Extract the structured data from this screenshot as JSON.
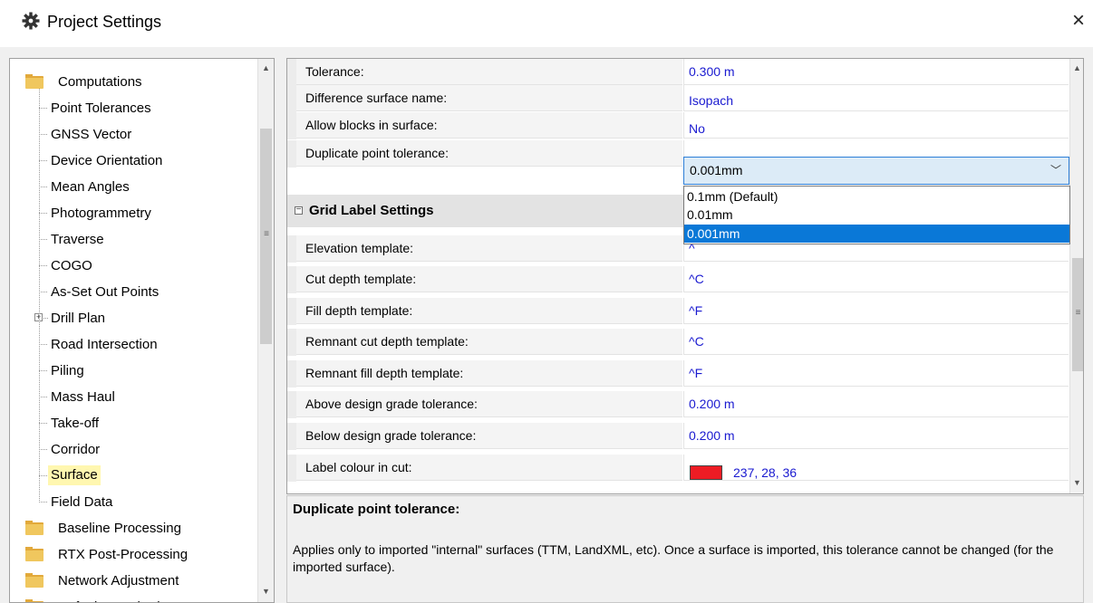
{
  "window": {
    "title": "Project Settings",
    "close_label": "×"
  },
  "tree": {
    "items": [
      {
        "label": "Computations",
        "type": "folder"
      },
      {
        "label": "Point Tolerances",
        "type": "leaf"
      },
      {
        "label": "GNSS Vector",
        "type": "leaf"
      },
      {
        "label": "Device Orientation",
        "type": "leaf"
      },
      {
        "label": "Mean Angles",
        "type": "leaf"
      },
      {
        "label": "Photogrammetry",
        "type": "leaf"
      },
      {
        "label": "Traverse",
        "type": "leaf"
      },
      {
        "label": "COGO",
        "type": "leaf"
      },
      {
        "label": "As-Set Out Points",
        "type": "leaf"
      },
      {
        "label": "Drill Plan",
        "type": "expandable"
      },
      {
        "label": "Road Intersection",
        "type": "leaf"
      },
      {
        "label": "Piling",
        "type": "leaf"
      },
      {
        "label": "Mass Haul",
        "type": "leaf"
      },
      {
        "label": "Take-off",
        "type": "leaf"
      },
      {
        "label": "Corridor",
        "type": "leaf"
      },
      {
        "label": "Surface",
        "type": "leaf",
        "selected": true
      },
      {
        "label": "Field Data",
        "type": "leaf"
      },
      {
        "label": "Baseline Processing",
        "type": "folder"
      },
      {
        "label": "RTX Post-Processing",
        "type": "folder"
      },
      {
        "label": "Network Adjustment",
        "type": "folder"
      },
      {
        "label": "Default Standard Errors",
        "type": "folder"
      }
    ]
  },
  "grid": {
    "rows_top": [
      {
        "name": "Tolerance:",
        "value": "0.300 m"
      },
      {
        "name": "Difference surface name:",
        "value": "Isopach"
      },
      {
        "name": "Allow blocks in surface:",
        "value": "No"
      },
      {
        "name": "Duplicate point tolerance:",
        "value": ""
      }
    ],
    "category": {
      "label": "Grid Label Settings",
      "toggle": "−"
    },
    "rows_bottom": [
      {
        "name": "Elevation template:",
        "value": "^"
      },
      {
        "name": "Cut depth template:",
        "value": "^C"
      },
      {
        "name": "Fill depth template:",
        "value": "^F"
      },
      {
        "name": "Remnant cut depth template:",
        "value": "^C"
      },
      {
        "name": "Remnant fill depth template:",
        "value": "^F"
      },
      {
        "name": "Above design grade tolerance:",
        "value": "0.200 m"
      },
      {
        "name": "Below design grade tolerance:",
        "value": "0.200 m"
      },
      {
        "name": "Label colour in cut:",
        "value": "237, 28, 36",
        "swatch_color": "#ed1c24"
      }
    ]
  },
  "combo": {
    "selected": "0.001mm",
    "options": [
      "0.1mm (Default)",
      "0.01mm",
      "0.001mm"
    ],
    "highlighted_index": 2
  },
  "description": {
    "title": "Duplicate point tolerance:",
    "body": "Applies only to imported \"internal\" surfaces (TTM, LandXML, etc). Once a surface is imported, this tolerance cannot be changed (for the imported surface)."
  },
  "colors": {
    "accent": "#0a78d7",
    "value_text": "#1a1ad0",
    "selected_bg": "#fff7b0"
  }
}
